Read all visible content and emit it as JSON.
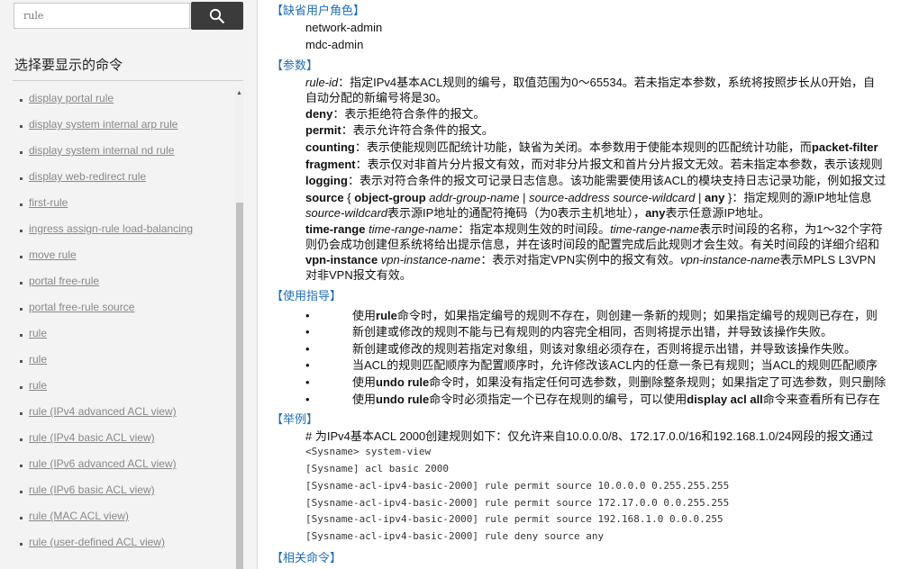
{
  "search": {
    "value": "rule"
  },
  "sidebar": {
    "title": "选择要显示的命令",
    "items": [
      "display portal rule",
      "display system internal arp rule",
      "display system internal nd rule",
      "display web-redirect rule",
      "first-rule",
      "ingress assign-rule load-balancing",
      "move rule",
      "portal free-rule",
      "portal free-rule source",
      "rule",
      "rule",
      "rule",
      "rule (IPv4 advanced ACL view)",
      "rule (IPv4 basic ACL view)",
      "rule (IPv6 advanced ACL view)",
      "rule (IPv6 basic ACL view)",
      "rule (MAC ACL view)",
      "rule (user-defined ACL view)"
    ]
  },
  "content": {
    "default_roles_heading": "【缺省用户角色】",
    "roles": [
      "network-admin",
      "mdc-admin"
    ],
    "params_heading": "【参数】",
    "params": {
      "rule_id_a": "rule-id",
      "rule_id_b": "：指定IPv4基本ACL规则的编号，取值范围为0～65534。若未指定本参数，系统将按照步长从0开始，自",
      "rule_id_c": "自动分配的新编号将是30。",
      "deny_a": "deny",
      "deny_b": "：表示拒绝符合条件的报文。",
      "permit_a": "permit",
      "permit_b": "：表示允许符合条件的报文。",
      "counting_a": "counting",
      "counting_b": "：表示使能规则匹配统计功能，缺省为关闭。本参数用于使能本规则的匹配统计功能，而",
      "counting_c": "packet-filter",
      "fragment_a": "fragment",
      "fragment_b": "：表示仅对非首片分片报文有效，而对非分片报文和首片分片报文无效。若未指定本参数，表示该规则",
      "logging_a": "logging",
      "logging_b": "：表示对符合条件的报文可记录日志信息。该功能需要使用该ACL的模块支持日志记录功能，例如报文过",
      "source_a": "source",
      "source_b": " { ",
      "source_c": "object-group",
      "source_d": " addr-group-name",
      "source_e": " | ",
      "source_f": "source-address source-wildcard",
      "source_g": " | ",
      "source_h": "any",
      "source_i": " }：指定规则的源IP地址信息",
      "source2_a": "source-wildcard",
      "source2_b": "表示源IP地址的通配符掩码（为0表示主机地址），",
      "source2_c": "any",
      "source2_d": "表示任意源IP地址。",
      "timerange_a": "time-range",
      "timerange_b": " time-range-name",
      "timerange_c": "：指定本规则生效的时间段。",
      "timerange_d": "time-range-name",
      "timerange_e": "表示时间段的名称，为1～32个字符",
      "timerange2": "则仍会成功创建但系统将给出提示信息，并在该时间段的配置完成后此规则才会生效。有关时间段的详细介绍和",
      "vpn_a": "vpn-instance",
      "vpn_b": " vpn-instance-name",
      "vpn_c": "：表示对指定VPN实例中的报文有效。",
      "vpn_d": "vpn-instance-name",
      "vpn_e": "表示MPLS L3VPN",
      "vpn2": "对非VPN报文有效。"
    },
    "usage_heading": "【使用指导】",
    "usage": {
      "u1_a": "使用",
      "u1_b": "rule",
      "u1_c": "命令时，如果指定编号的规则不存在，则创建一条新的规则；如果指定编号的规则已存在，则",
      "u2": "新创建或修改的规则不能与已有规则的内容完全相同，否则将提示出错，并导致该操作失败。",
      "u3": "新创建或修改的规则若指定对象组，则该对象组必须存在，否则将提示出错，并导致该操作失败。",
      "u4": "当ACL的规则匹配顺序为配置顺序时，允许修改该ACL内的任意一条已有规则；当ACL的规则匹配顺序",
      "u5_a": "使用",
      "u5_b": "undo rule",
      "u5_c": "命令时，如果没有指定任何可选参数，则删除整条规则；如果指定了可选参数，则只删除",
      "u6_a": "使用",
      "u6_b": "undo rule",
      "u6_c": "命令时必须指定一个已存在规则的编号，可以使用",
      "u6_d": "display acl all",
      "u6_e": "命令来查看所有已存在",
      "bullet": "•"
    },
    "example_heading": "【举例】",
    "example_intro": "# 为IPv4基本ACL 2000创建规则如下：仅允许来自10.0.0.0/8、172.17.0.0/16和192.168.1.0/24网段的报文通过",
    "code": [
      "<Sysname> system-view",
      "[Sysname] acl basic 2000",
      "[Sysname-acl-ipv4-basic-2000] rule permit source 10.0.0.0 0.255.255.255",
      "[Sysname-acl-ipv4-basic-2000] rule permit source 172.17.0.0 0.0.255.255",
      "[Sysname-acl-ipv4-basic-2000] rule permit source 192.168.1.0 0.0.0.255",
      "[Sysname-acl-ipv4-basic-2000] rule deny source any"
    ],
    "related_heading": "【相关命令】"
  },
  "colors": {
    "heading": "#1f6fb5",
    "search_button": "#3b3b3b",
    "link": "#888888"
  }
}
